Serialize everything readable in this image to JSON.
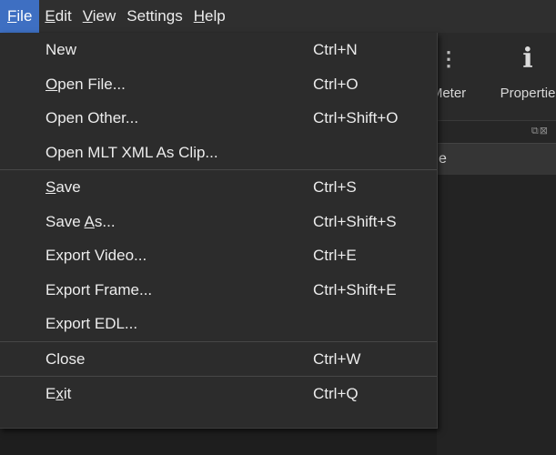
{
  "menubar": {
    "items": [
      {
        "label": "File",
        "mnemonic_index": 0,
        "active": true
      },
      {
        "label": "Edit",
        "mnemonic_index": 0,
        "active": false
      },
      {
        "label": "View",
        "mnemonic_index": 0,
        "active": false
      },
      {
        "label": "Settings",
        "mnemonic_index": -1,
        "active": false
      },
      {
        "label": "Help",
        "mnemonic_index": 0,
        "active": false
      }
    ]
  },
  "toolbar": {
    "meter_label": "Meter",
    "properties_label": "Propertie"
  },
  "dock": {
    "header_text": "e",
    "buttons": "⧉⊠"
  },
  "file_menu": {
    "groups": [
      [
        {
          "label": "New",
          "mnemonic_index": -1,
          "shortcut": "Ctrl+N"
        },
        {
          "label": "Open File...",
          "mnemonic_index": 0,
          "shortcut": "Ctrl+O"
        },
        {
          "label": "Open Other...",
          "mnemonic_index": -1,
          "shortcut": "Ctrl+Shift+O"
        },
        {
          "label": "Open MLT XML As Clip...",
          "mnemonic_index": -1,
          "shortcut": ""
        }
      ],
      [
        {
          "label": "Save",
          "mnemonic_index": 0,
          "shortcut": "Ctrl+S"
        },
        {
          "label": "Save As...",
          "mnemonic_index": 5,
          "shortcut": "Ctrl+Shift+S"
        },
        {
          "label": "Export Video...",
          "mnemonic_index": -1,
          "shortcut": "Ctrl+E"
        },
        {
          "label": "Export Frame...",
          "mnemonic_index": -1,
          "shortcut": "Ctrl+Shift+E"
        },
        {
          "label": "Export EDL...",
          "mnemonic_index": -1,
          "shortcut": ""
        }
      ],
      [
        {
          "label": "Close",
          "mnemonic_index": -1,
          "shortcut": "Ctrl+W"
        }
      ],
      [
        {
          "label": "Exit",
          "mnemonic_index": 1,
          "shortcut": "Ctrl+Q"
        }
      ]
    ]
  },
  "colors": {
    "menubar_bg": "#2f2f2f",
    "active_menu_bg": "#3e6fc2",
    "menu_bg": "#2c2c2c",
    "separator": "#474747"
  }
}
